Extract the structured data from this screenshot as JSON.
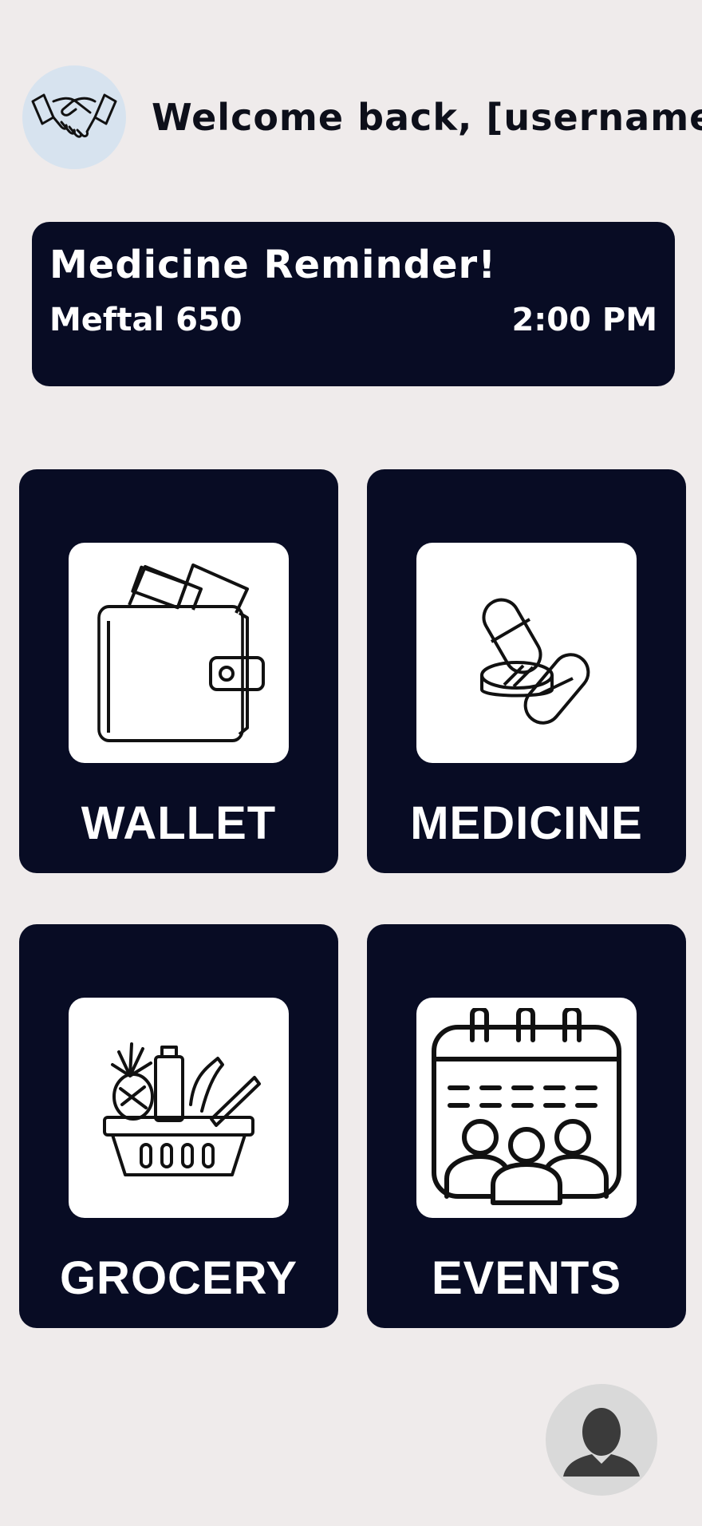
{
  "header": {
    "welcome_text": "Welcome back, [username]",
    "logo_icon": "handshake-icon"
  },
  "reminder": {
    "title": "Medicine Reminder!",
    "medicine_name": "Meftal 650",
    "time": "2:00 PM"
  },
  "tiles": [
    {
      "label": "WALLET",
      "icon": "wallet-icon"
    },
    {
      "label": "MEDICINE",
      "icon": "pills-icon"
    },
    {
      "label": "GROCERY",
      "icon": "grocery-basket-icon"
    },
    {
      "label": "EVENTS",
      "icon": "calendar-people-icon"
    }
  ],
  "profile": {
    "icon": "user-avatar-icon"
  },
  "colors": {
    "background": "#efebeb",
    "card": "#080c24",
    "text_dark": "#0d0f1a",
    "avatar_bg": "#d7e3ef",
    "profile_bg": "#d9d9d9"
  }
}
